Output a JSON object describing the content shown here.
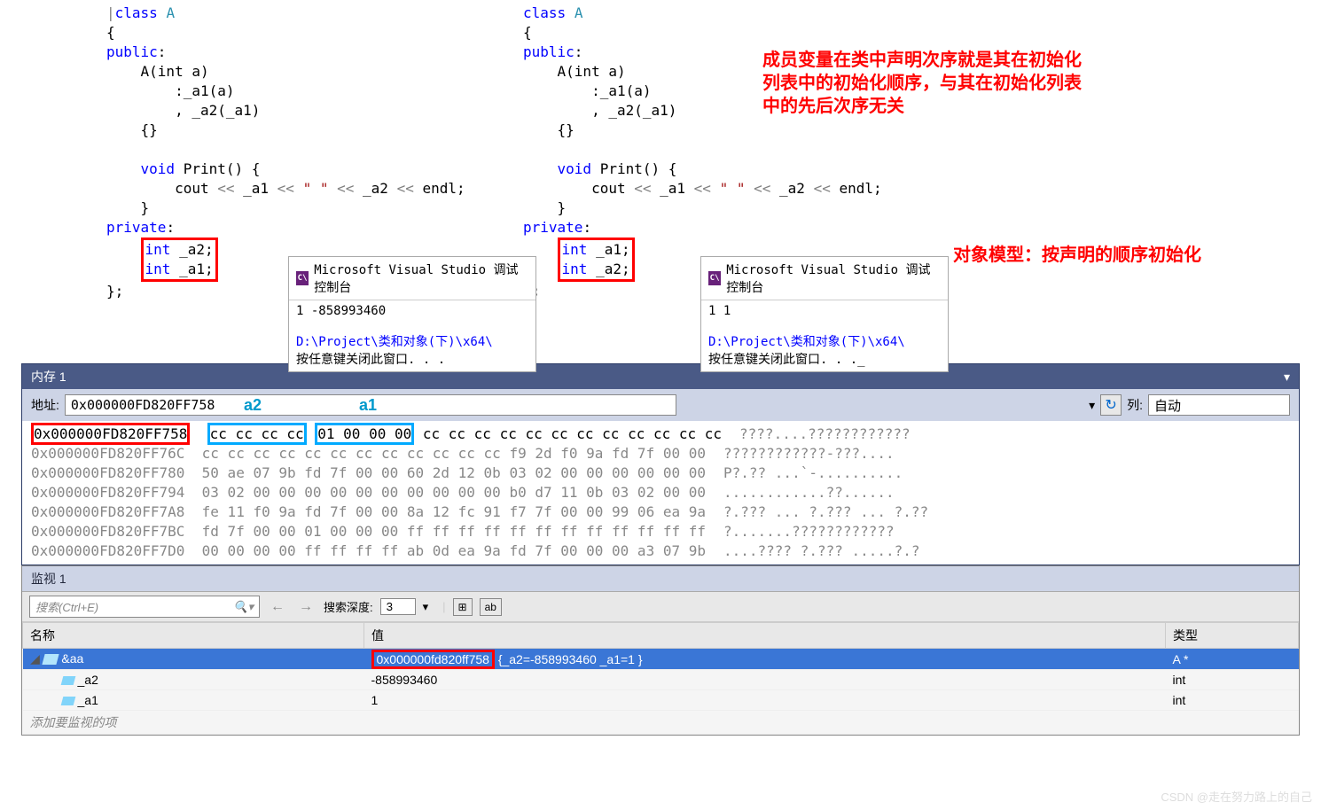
{
  "code_left": {
    "class_kw": "class",
    "class_name": "A",
    "public_kw": "public",
    "ctor": "A(int a)",
    "init1": ":_a1(a)",
    "init2": ", _a2(_a1)",
    "print_sig": "void Print() {",
    "print_body": "cout << _a1 << \" \" << _a2 << endl;",
    "private_kw": "private",
    "member1": "int _a2;",
    "member2": "int _a1;"
  },
  "code_right": {
    "member1": "int _a1;",
    "member2": "int _a2;"
  },
  "console_left": {
    "title": "Microsoft Visual Studio 调试控制台",
    "output": "1 -858993460",
    "path": "D:\\Project\\类和对象(下)\\x64\\",
    "prompt": "按任意键关闭此窗口. . ."
  },
  "console_right": {
    "title": "Microsoft Visual Studio 调试控制台",
    "output": "1 1",
    "path": "D:\\Project\\类和对象(下)\\x64\\",
    "prompt": "按任意键关闭此窗口. . ._"
  },
  "annotation1": "成员变量在类中声明次序就是其在初始化列表中的初始化顺序，与其在初始化列表中的先后次序无关",
  "annotation2": "对象模型：按声明的顺序初始化",
  "memory": {
    "title": "内存 1",
    "addr_label": "地址:",
    "addr_value": "0x000000FD820FF758",
    "a2_label": "a2",
    "a1_label": "a1",
    "col_label": "列:",
    "col_value": "自动",
    "rows": [
      {
        "addr": "0x000000FD820FF758",
        "bytes_a2": "cc cc cc cc",
        "bytes_a1": "01 00 00 00",
        "rest": "cc cc cc cc cc cc cc cc cc cc cc cc",
        "ascii": "????....????????????"
      },
      {
        "addr": "0x000000FD820FF76C",
        "bytes": "cc cc cc cc cc cc cc cc cc cc cc cc f9 2d f0 9a fd 7f 00 00",
        "ascii": "????????????-???...."
      },
      {
        "addr": "0x000000FD820FF780",
        "bytes": "50 ae 07 9b fd 7f 00 00 60 2d 12 0b 03 02 00 00 00 00 00 00",
        "ascii": "P?.?? ...`-.........."
      },
      {
        "addr": "0x000000FD820FF794",
        "bytes": "03 02 00 00 00 00 00 00 00 00 00 00 b0 d7 11 0b 03 02 00 00",
        "ascii": "............??......"
      },
      {
        "addr": "0x000000FD820FF7A8",
        "bytes": "fe 11 f0 9a fd 7f 00 00 8a 12 fc 91 f7 7f 00 00 99 06 ea 9a",
        "ascii": "?.??? ... ?.??? ... ?.??"
      },
      {
        "addr": "0x000000FD820FF7BC",
        "bytes": "fd 7f 00 00 01 00 00 00 ff ff ff ff ff ff ff ff ff ff ff ff",
        "ascii": "?.......????????????"
      },
      {
        "addr": "0x000000FD820FF7D0",
        "bytes": "00 00 00 00 ff ff ff ff ab 0d ea 9a fd 7f 00 00 00 a3 07 9b",
        "ascii": "....???? ?.??? .....?.?"
      }
    ]
  },
  "watch": {
    "title": "监视 1",
    "search_placeholder": "搜索(Ctrl+E)",
    "depth_label": "搜索深度:",
    "depth_value": "3",
    "cols": {
      "name": "名称",
      "value": "值",
      "type": "类型"
    },
    "rows": [
      {
        "name": "&aa",
        "value_addr": "0x000000fd820ff758",
        "value_rest": "{_a2=-858993460 _a1=1 }",
        "type": "A *",
        "selected": true,
        "icon": "object",
        "expand": "▢"
      },
      {
        "name": "_a2",
        "value": "-858993460",
        "type": "int",
        "icon": "field"
      },
      {
        "name": "_a1",
        "value": "1",
        "type": "int",
        "icon": "field"
      }
    ],
    "add_prompt": "添加要监视的项"
  },
  "watermark": "CSDN @走在努力路上的自己"
}
